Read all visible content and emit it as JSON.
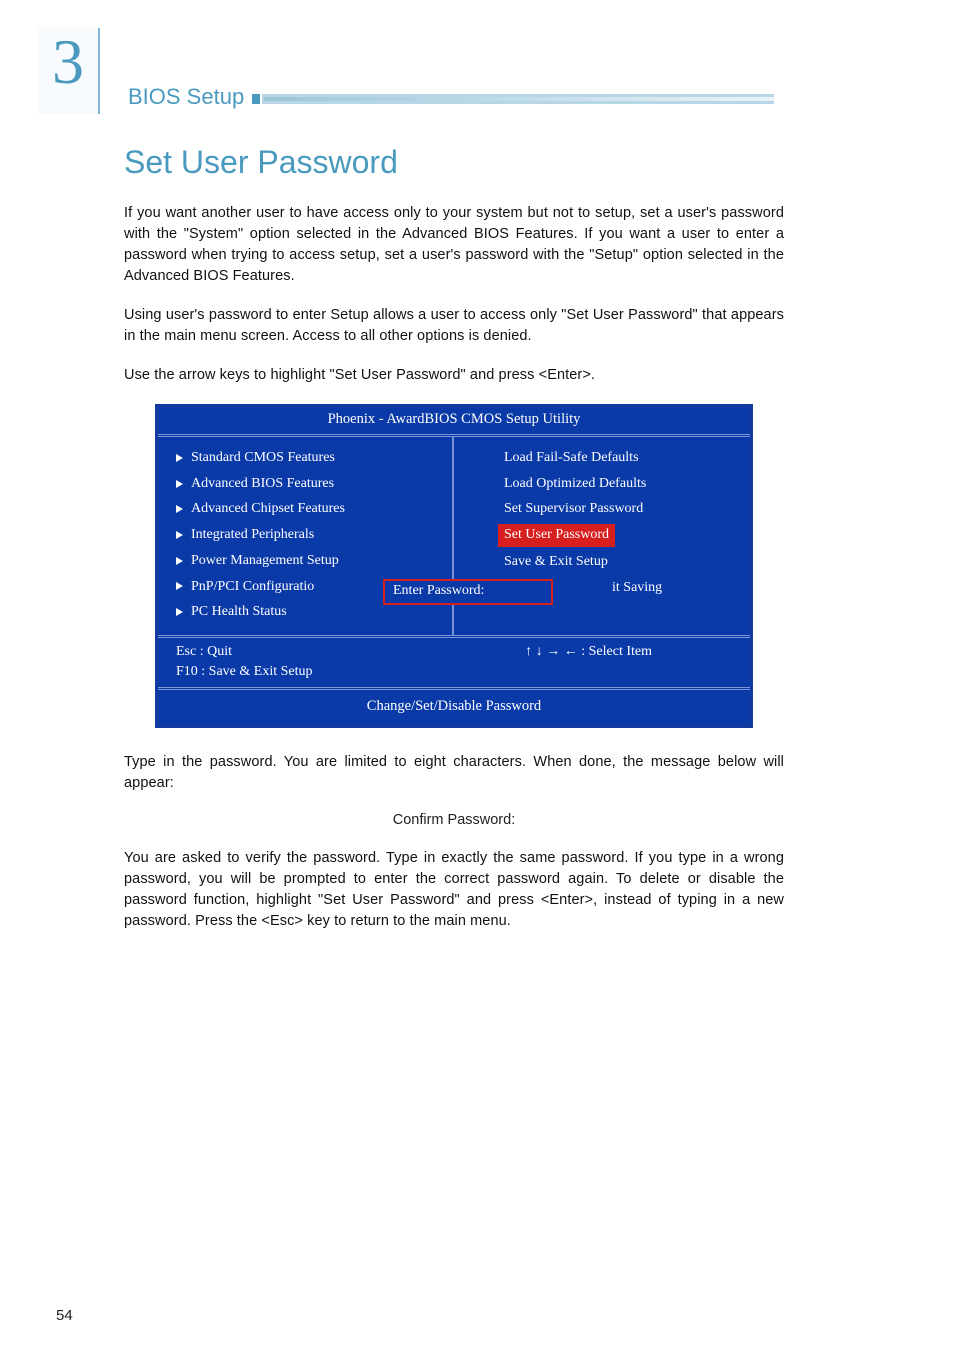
{
  "chapter_number": "3",
  "header_title": "BIOS Setup",
  "section_title": "Set User Password",
  "paragraphs": {
    "p1": "If you want another user to have access only to your system but not to setup, set a user's password with the \"System\" option selected in the Advanced BIOS Features. If you want a user to enter a password when trying to access setup, set a user's password with the \"Setup\" option selected in the Advanced BIOS Features.",
    "p2": "Using user's password to enter Setup allows a user to access only \"Set User Password\" that appears in the main menu screen. Access to all other options is denied.",
    "p3": "Use the arrow keys to highlight \"Set User Password\" and press <Enter>.",
    "p4": "Type in the password. You are limited to eight characters. When done, the message below will appear:",
    "confirm": "Confirm Password:",
    "p5": "You are asked to verify the password. Type in exactly the same password. If you type in a wrong password, you will be prompted to enter the correct password again. To delete or disable the password function, highlight \"Set User Password\" and press <Enter>, instead of typing in a new password. Press the <Esc> key to return to the main menu."
  },
  "bios": {
    "title": "Phoenix - AwardBIOS CMOS Setup Utility",
    "left_items": [
      "Standard CMOS Features",
      "Advanced BIOS Features",
      "Advanced Chipset Features",
      "Integrated Peripherals",
      "Power Management Setup",
      "PnP/PCI Configuratio",
      "PC Health Status"
    ],
    "right_items": [
      "Load Fail-Safe Defaults",
      "Load Optimized Defaults",
      "Set Supervisor Password",
      "Set User Password",
      "Save & Exit Setup",
      "it Saving"
    ],
    "right_highlight_index": 3,
    "right_last_indent": true,
    "dialog_label": "Enter Password:",
    "footer_esc": "Esc   :  Quit",
    "footer_f10": "F10  :  Save & Exit Setup",
    "footer_select": "↑ ↓ → ← : Select Item",
    "footer_msg": "Change/Set/Disable Password"
  },
  "page_number": "54"
}
